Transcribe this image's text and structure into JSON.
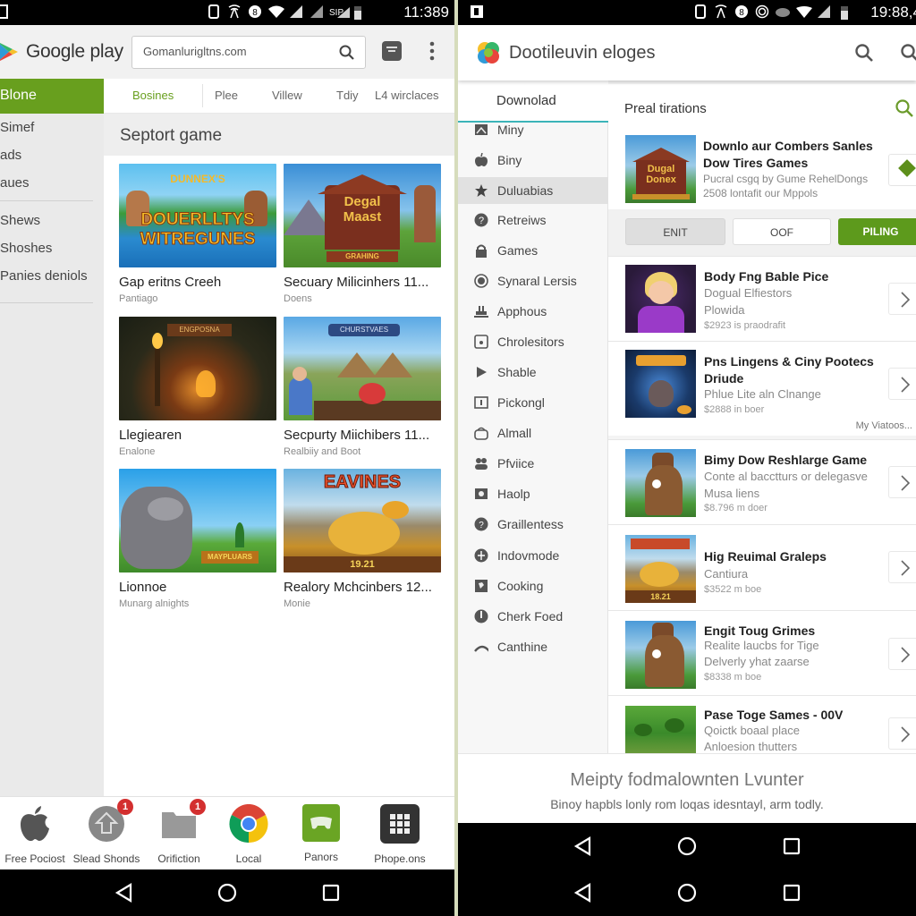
{
  "left_phone": {
    "status_bar": {
      "time": "11:389",
      "icons": [
        "notification-icon",
        "phone-icon",
        "signal-tower-icon",
        "data-saver-icon",
        "wifi-icon",
        "cell-signal-icon",
        "cell-signal-icon",
        "roaming-icon",
        "battery-icon"
      ]
    },
    "header": {
      "app_title": "Google play",
      "search_value": "Gomanlurigltns.com",
      "search_icon": "search-icon",
      "cart_icon": "cart-icon",
      "more_icon": "more-vert-icon"
    },
    "sidebar": {
      "active_item": "Blone",
      "items_group1": [
        "Simef",
        "ads",
        "aues"
      ],
      "items_group2": [
        "Shews",
        "Shoshes",
        "Panies deniols"
      ]
    },
    "tabs": [
      {
        "label": "Bosines",
        "active": true
      },
      {
        "label": "Plee",
        "active": false
      },
      {
        "label": "Villew",
        "active": false
      },
      {
        "label": "Tdiy",
        "active": false
      },
      {
        "label": "L4 wirclaces",
        "active": false
      }
    ],
    "section_title": "Septort game",
    "games": [
      {
        "title": "Gap eritns Creeh",
        "subtitle": "Pantiago",
        "art_text": "DOUERLLTYS WITREGUNES",
        "art_top": "DUNNEX'S"
      },
      {
        "title": "Secuary Milicinhers 11...",
        "subtitle": "Doens",
        "art_text": "Degal Maast",
        "art_top": "GRAHING"
      },
      {
        "title": "Llegiearen",
        "subtitle": "Enalone",
        "art_text": "ENGPOSNA"
      },
      {
        "title": "Secpurty Miichibers 11...",
        "subtitle": "Realbiiy and Boot",
        "art_text": "CHURSTVAES"
      },
      {
        "title": "Lionnoe",
        "subtitle": "Munarg alnights",
        "art_text": "MAYPLUARS"
      },
      {
        "title": "Realory Mchcinbers 12...",
        "subtitle": "Monie",
        "art_text": "EAVINES",
        "art_bottom": "19.21"
      }
    ],
    "dock": [
      {
        "label": "Free Pociost",
        "icon": "apple-icon",
        "badge": null
      },
      {
        "label": "Slead Shonds",
        "icon": "home-upload-icon",
        "badge": "1"
      },
      {
        "label": "Orifiction",
        "icon": "folder-icon",
        "badge": "1"
      },
      {
        "label": "Local",
        "icon": "chrome-icon",
        "badge": null
      },
      {
        "label": "Panors",
        "icon": "gamepad-icon",
        "badge": null
      },
      {
        "label": "Phope.ons",
        "icon": "apps-grid-icon",
        "badge": null
      }
    ]
  },
  "right_phone": {
    "status_bar": {
      "time": "19:88,4",
      "icons": [
        "notification-icon",
        "phone-icon",
        "signal-tower-icon",
        "data-saver-icon",
        "sync-icon",
        "cloud-icon",
        "wifi-icon",
        "cell-signal-icon",
        "battery-icon"
      ]
    },
    "header": {
      "app_title": "Dootileuvin eloges"
    },
    "sidebar": {
      "tab_label": "Downolad",
      "items": [
        {
          "label": "Miny",
          "icon": "image-icon",
          "selected": false
        },
        {
          "label": "Biny",
          "icon": "apple-icon",
          "selected": false
        },
        {
          "label": "Duluabias",
          "icon": "star-icon",
          "selected": true
        },
        {
          "label": "Retreiws",
          "icon": "help-circle-icon",
          "selected": false
        },
        {
          "label": "Games",
          "icon": "lock-icon",
          "selected": false
        },
        {
          "label": "Synaral Lersis",
          "icon": "radio-button-icon",
          "selected": false
        },
        {
          "label": "Apphous",
          "icon": "cake-icon",
          "selected": false
        },
        {
          "label": "Chrolesitors",
          "icon": "square-face-icon",
          "selected": false
        },
        {
          "label": "Shable",
          "icon": "play-icon",
          "selected": false
        },
        {
          "label": "Pickongl",
          "icon": "box-icon",
          "selected": false
        },
        {
          "label": "Almall",
          "icon": "mail-bag-icon",
          "selected": false
        },
        {
          "label": "Pfviice",
          "icon": "people-icon",
          "selected": false
        },
        {
          "label": "Haolp",
          "icon": "camera-icon",
          "selected": false
        },
        {
          "label": "Graillentess",
          "icon": "chat-bubble-icon",
          "selected": false
        },
        {
          "label": "Indovmode",
          "icon": "globe-icon",
          "selected": false
        },
        {
          "label": "Cooking",
          "icon": "puzzle-icon",
          "selected": false
        },
        {
          "label": "Cherk Foed",
          "icon": "power-icon",
          "selected": false
        },
        {
          "label": "Canthine",
          "icon": "wifi-arc-icon",
          "selected": false
        }
      ]
    },
    "main": {
      "heading": "Preal tirations",
      "featured": {
        "title": "Downlo aur Combers Sanles Dow Tires Games",
        "line1": "Pucral csgq by Gume RehelDongs",
        "line2": "2508 lontafit our Mppols",
        "art_text": "Dugal Donex"
      },
      "buttons": {
        "exit": "ENIT",
        "off": "OOF",
        "primary": "PILING"
      },
      "list": [
        {
          "title": "Body Fng Bable Pice",
          "line1": "Dogual Elfiestors",
          "line2": "Plowida",
          "price": "$2923 is praodrafit"
        },
        {
          "title": "Pns Lingens & Ciny Pootecs Driude",
          "line1": "Phlue Lite aln Clnange",
          "line2": "",
          "price": "$2888 in boer",
          "more": "My Viatoos..."
        },
        {
          "title": "Bimy Dow Reshlarge Game",
          "line1": "Conte al bacctturs or delegasve",
          "line2": "Musa liens",
          "price": "$8.796 m doer"
        },
        {
          "title": "Hig Reuimal Graleps",
          "line1": "Cantiura",
          "line2": "",
          "price": "$3522 m boe"
        },
        {
          "title": "Engit Toug Grimes",
          "line1": "Realite laucbs for Tige",
          "line2": "Delverly yhat zaarse",
          "price": "$8338 m boe"
        },
        {
          "title": "Pase Toge Sames - 00V",
          "line1": "Qoictk boaal place",
          "line2": "Anloesion thutters",
          "price": ""
        }
      ]
    },
    "footer": {
      "title": "Meipty fodmalownten Lvunter",
      "subtitle": "Binoy hapbls lonly rom loqas idesntayl, arm todly."
    }
  },
  "colors": {
    "brand_green": "#689f1e",
    "button_green": "#5d9a1c",
    "tab_underline": "#3bb4b8",
    "badge_red": "#d32f2f"
  }
}
